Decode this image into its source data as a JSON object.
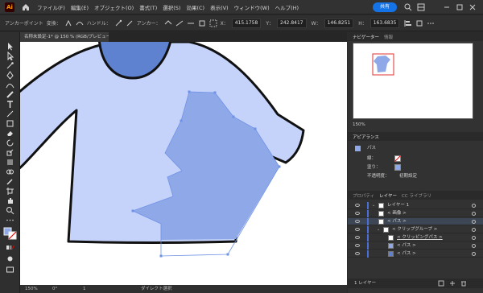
{
  "app": {
    "logo": "Ai"
  },
  "menu": [
    "ファイル(F)",
    "編集(E)",
    "オブジェクト(O)",
    "書式(T)",
    "選択(S)",
    "効果(C)",
    "表示(V)",
    "ウィンドウ(W)",
    "ヘルプ(H)"
  ],
  "share_label": "共有",
  "controlbar": {
    "anchor_label": "アンカーポイント",
    "convert_label": "変換：",
    "handle_label": "ハンドル：",
    "anchor2_label": "アンカー：",
    "x_label": "X：",
    "x_value": "415.1758",
    "y_label": "Y：",
    "y_value": "242.8417",
    "w_label": "W：",
    "w_value": "146.8251",
    "h_label": "H：",
    "h_value": "163.6835"
  },
  "document_tab": "名称未設定-1* @ 150 % (RGB/プレビュー)",
  "status": {
    "zoom": "150%",
    "angle": "0°",
    "page": "1",
    "mode": "ダイレクト選択"
  },
  "panel": {
    "navigator_tabs": [
      "ナビゲーター",
      "情報"
    ],
    "nav_zoom": "150%",
    "appearance_title": "アピアランス",
    "appearance_object": "パス",
    "stroke_label": "線：",
    "fill_label": "塗り：",
    "opacity_label": "不透明度：",
    "opacity_value": "初期設定",
    "layer_tabs": [
      "プロパティ",
      "レイヤー",
      "CC ライブラリ"
    ],
    "layers": [
      {
        "name": "レイヤー 1"
      },
      {
        "name": "< 画像 >"
      },
      {
        "name": "< パス >"
      },
      {
        "name": "< クリップグループ >"
      },
      {
        "name": "< クリッピングパス >"
      },
      {
        "name": "< パス >"
      },
      {
        "name": "< パス >"
      }
    ],
    "layer_count": "1 レイヤー"
  },
  "colors": {
    "shirt_body": "#c5d3fb",
    "shirt_collar": "#5e81d0",
    "clip_shape": "#8fa9e8",
    "path_stroke": "#6f91e6",
    "accent": "#1473e6"
  }
}
